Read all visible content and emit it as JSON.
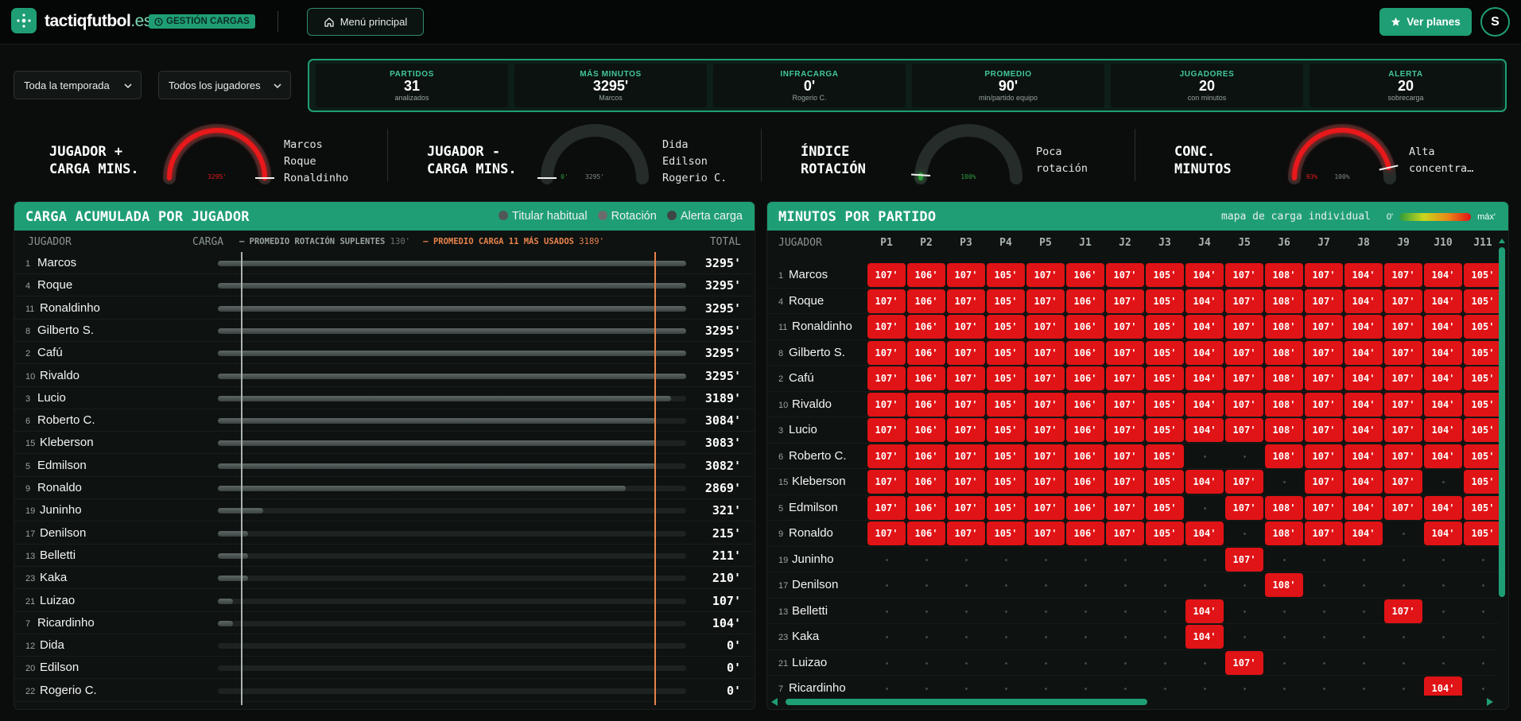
{
  "header": {
    "brand_main": "tactiqfutbol",
    "brand_suffix": ".es",
    "badge": "GESTIÓN CARGAS",
    "menu_label": "Menú principal",
    "plans_label": "Ver planes",
    "avatar": "S"
  },
  "filters": {
    "season": "Toda la temporada",
    "players": "Todos los jugadores"
  },
  "kpis": [
    {
      "label": "PARTIDOS",
      "value": "31",
      "sub": "analizados"
    },
    {
      "label": "MÁS MINUTOS",
      "value": "3295'",
      "sub": "Marcos"
    },
    {
      "label": "INFRACARGA",
      "value": "0'",
      "sub": "Rogerio C."
    },
    {
      "label": "PROMEDIO",
      "value": "90'",
      "sub": "min/partido equipo"
    },
    {
      "label": "JUGADORES",
      "value": "20",
      "sub": "con minutos"
    },
    {
      "label": "ALERTA",
      "value": "20",
      "sub": "sobrecarga"
    }
  ],
  "gauges": [
    {
      "title": "JUGADOR +\nCARGA MINS.",
      "value_label": "3295'",
      "fill": 1.0,
      "color": "#e8181b",
      "names": [
        "Marcos",
        "Roque",
        "Ronaldinho"
      ]
    },
    {
      "title": "JUGADOR -\nCARGA MINS.",
      "value_label": "0'",
      "max_label": "3295'",
      "fill": 0.0,
      "color": "#2e9c3a",
      "names": [
        "Dida",
        "Edilson",
        "Rogerio C."
      ]
    },
    {
      "title": "ÍNDICE\nROTACIÓN",
      "value_label": "100%",
      "fill": 0.02,
      "color": "#2e9c3a",
      "names": [
        "Poca",
        "rotación"
      ]
    },
    {
      "title": "CONC.\nMINUTOS",
      "value_label": "93%",
      "max_label": "100%",
      "fill": 0.93,
      "color": "#e8181b",
      "names": [
        "Alta",
        "concentra…"
      ]
    }
  ],
  "load_panel": {
    "title": "CARGA ACUMULADA POR JUGADOR",
    "legend": [
      {
        "label": "Titular habitual",
        "color": "#4f5855"
      },
      {
        "label": "Rotación",
        "color": "#6b6b6b"
      },
      {
        "label": "Alerta carga",
        "color": "#3d4644"
      }
    ],
    "col_player": "JUGADOR",
    "col_load": "CARGA",
    "col_total": "TOTAL",
    "ref_subs_label": "PROMEDIO ROTACIÓN SUPLENTES",
    "ref_subs_value": 130,
    "ref_subs_text": "130'",
    "ref_top_label": "PROMEDIO CARGA 11 MÁS USADOS",
    "ref_top_value": 3189,
    "ref_top_text": "3189'",
    "max_value": 3295
  },
  "players": [
    {
      "num": "1",
      "name": "Marcos",
      "total": 3295,
      "total_text": "3295'"
    },
    {
      "num": "4",
      "name": "Roque",
      "total": 3295,
      "total_text": "3295'"
    },
    {
      "num": "11",
      "name": "Ronaldinho",
      "total": 3295,
      "total_text": "3295'"
    },
    {
      "num": "8",
      "name": "Gilberto S.",
      "total": 3295,
      "total_text": "3295'"
    },
    {
      "num": "2",
      "name": "Cafú",
      "total": 3295,
      "total_text": "3295'"
    },
    {
      "num": "10",
      "name": "Rivaldo",
      "total": 3295,
      "total_text": "3295'"
    },
    {
      "num": "3",
      "name": "Lucio",
      "total": 3189,
      "total_text": "3189'"
    },
    {
      "num": "6",
      "name": "Roberto C.",
      "total": 3084,
      "total_text": "3084'"
    },
    {
      "num": "15",
      "name": "Kleberson",
      "total": 3083,
      "total_text": "3083'"
    },
    {
      "num": "5",
      "name": "Edmilson",
      "total": 3082,
      "total_text": "3082'"
    },
    {
      "num": "9",
      "name": "Ronaldo",
      "total": 2869,
      "total_text": "2869'"
    },
    {
      "num": "19",
      "name": "Juninho",
      "total": 321,
      "total_text": "321'"
    },
    {
      "num": "17",
      "name": "Denilson",
      "total": 215,
      "total_text": "215'"
    },
    {
      "num": "13",
      "name": "Belletti",
      "total": 211,
      "total_text": "211'"
    },
    {
      "num": "23",
      "name": "Kaka",
      "total": 210,
      "total_text": "210'"
    },
    {
      "num": "21",
      "name": "Luizao",
      "total": 107,
      "total_text": "107'"
    },
    {
      "num": "7",
      "name": "Ricardinho",
      "total": 104,
      "total_text": "104'"
    },
    {
      "num": "12",
      "name": "Dida",
      "total": 0,
      "total_text": "0'"
    },
    {
      "num": "20",
      "name": "Edilson",
      "total": 0,
      "total_text": "0'"
    },
    {
      "num": "22",
      "name": "Rogerio C.",
      "total": 0,
      "total_text": "0'"
    }
  ],
  "matrix": {
    "title": "MINUTOS POR PARTIDO",
    "legend_label": "mapa de carga individual",
    "legend_min": "0'",
    "legend_max": "máx'",
    "col_player": "JUGADOR",
    "matches": [
      "P1",
      "P2",
      "P3",
      "P4",
      "P5",
      "J1",
      "J2",
      "J3",
      "J4",
      "J5",
      "J6",
      "J7",
      "J8",
      "J9",
      "J10",
      "J11"
    ],
    "rows": [
      {
        "num": "1",
        "name": "Marcos",
        "cells": [
          "107'",
          "106'",
          "107'",
          "105'",
          "107'",
          "106'",
          "107'",
          "105'",
          "104'",
          "107'",
          "108'",
          "107'",
          "104'",
          "107'",
          "104'",
          "105'"
        ]
      },
      {
        "num": "4",
        "name": "Roque",
        "cells": [
          "107'",
          "106'",
          "107'",
          "105'",
          "107'",
          "106'",
          "107'",
          "105'",
          "104'",
          "107'",
          "108'",
          "107'",
          "104'",
          "107'",
          "104'",
          "105'"
        ]
      },
      {
        "num": "11",
        "name": "Ronaldinho",
        "cells": [
          "107'",
          "106'",
          "107'",
          "105'",
          "107'",
          "106'",
          "107'",
          "105'",
          "104'",
          "107'",
          "108'",
          "107'",
          "104'",
          "107'",
          "104'",
          "105'"
        ]
      },
      {
        "num": "8",
        "name": "Gilberto S.",
        "cells": [
          "107'",
          "106'",
          "107'",
          "105'",
          "107'",
          "106'",
          "107'",
          "105'",
          "104'",
          "107'",
          "108'",
          "107'",
          "104'",
          "107'",
          "104'",
          "105'"
        ]
      },
      {
        "num": "2",
        "name": "Cafú",
        "cells": [
          "107'",
          "106'",
          "107'",
          "105'",
          "107'",
          "106'",
          "107'",
          "105'",
          "104'",
          "107'",
          "108'",
          "107'",
          "104'",
          "107'",
          "104'",
          "105'"
        ]
      },
      {
        "num": "10",
        "name": "Rivaldo",
        "cells": [
          "107'",
          "106'",
          "107'",
          "105'",
          "107'",
          "106'",
          "107'",
          "105'",
          "104'",
          "107'",
          "108'",
          "107'",
          "104'",
          "107'",
          "104'",
          "105'"
        ]
      },
      {
        "num": "3",
        "name": "Lucio",
        "cells": [
          "107'",
          "106'",
          "107'",
          "105'",
          "107'",
          "106'",
          "107'",
          "105'",
          "104'",
          "107'",
          "108'",
          "107'",
          "104'",
          "107'",
          "104'",
          "105'"
        ]
      },
      {
        "num": "6",
        "name": "Roberto C.",
        "cells": [
          "107'",
          "106'",
          "107'",
          "105'",
          "107'",
          "106'",
          "107'",
          "105'",
          "",
          "",
          "108'",
          "107'",
          "104'",
          "107'",
          "104'",
          "105'"
        ]
      },
      {
        "num": "15",
        "name": "Kleberson",
        "cells": [
          "107'",
          "106'",
          "107'",
          "105'",
          "107'",
          "106'",
          "107'",
          "105'",
          "104'",
          "107'",
          "",
          "107'",
          "104'",
          "107'",
          "",
          "105'"
        ]
      },
      {
        "num": "5",
        "name": "Edmilson",
        "cells": [
          "107'",
          "106'",
          "107'",
          "105'",
          "107'",
          "106'",
          "107'",
          "105'",
          "",
          "107'",
          "108'",
          "107'",
          "104'",
          "107'",
          "104'",
          "105'"
        ]
      },
      {
        "num": "9",
        "name": "Ronaldo",
        "cells": [
          "107'",
          "106'",
          "107'",
          "105'",
          "107'",
          "106'",
          "107'",
          "105'",
          "104'",
          "",
          "108'",
          "107'",
          "104'",
          "",
          "104'",
          "105'"
        ]
      },
      {
        "num": "19",
        "name": "Juninho",
        "cells": [
          "",
          "",
          "",
          "",
          "",
          "",
          "",
          "",
          "",
          "107'",
          "",
          "",
          "",
          "",
          "",
          ""
        ]
      },
      {
        "num": "17",
        "name": "Denilson",
        "cells": [
          "",
          "",
          "",
          "",
          "",
          "",
          "",
          "",
          "",
          "",
          "108'",
          "",
          "",
          "",
          "",
          ""
        ]
      },
      {
        "num": "13",
        "name": "Belletti",
        "cells": [
          "",
          "",
          "",
          "",
          "",
          "",
          "",
          "",
          "104'",
          "",
          "",
          "",
          "",
          "107'",
          "",
          ""
        ]
      },
      {
        "num": "23",
        "name": "Kaka",
        "cells": [
          "",
          "",
          "",
          "",
          "",
          "",
          "",
          "",
          "104'",
          "",
          "",
          "",
          "",
          "",
          "",
          ""
        ]
      },
      {
        "num": "21",
        "name": "Luizao",
        "cells": [
          "",
          "",
          "",
          "",
          "",
          "",
          "",
          "",
          "",
          "107'",
          "",
          "",
          "",
          "",
          "",
          ""
        ]
      },
      {
        "num": "7",
        "name": "Ricardinho",
        "cells": [
          "",
          "",
          "",
          "",
          "",
          "",
          "",
          "",
          "",
          "",
          "",
          "",
          "",
          "",
          "104'",
          ""
        ]
      }
    ]
  }
}
